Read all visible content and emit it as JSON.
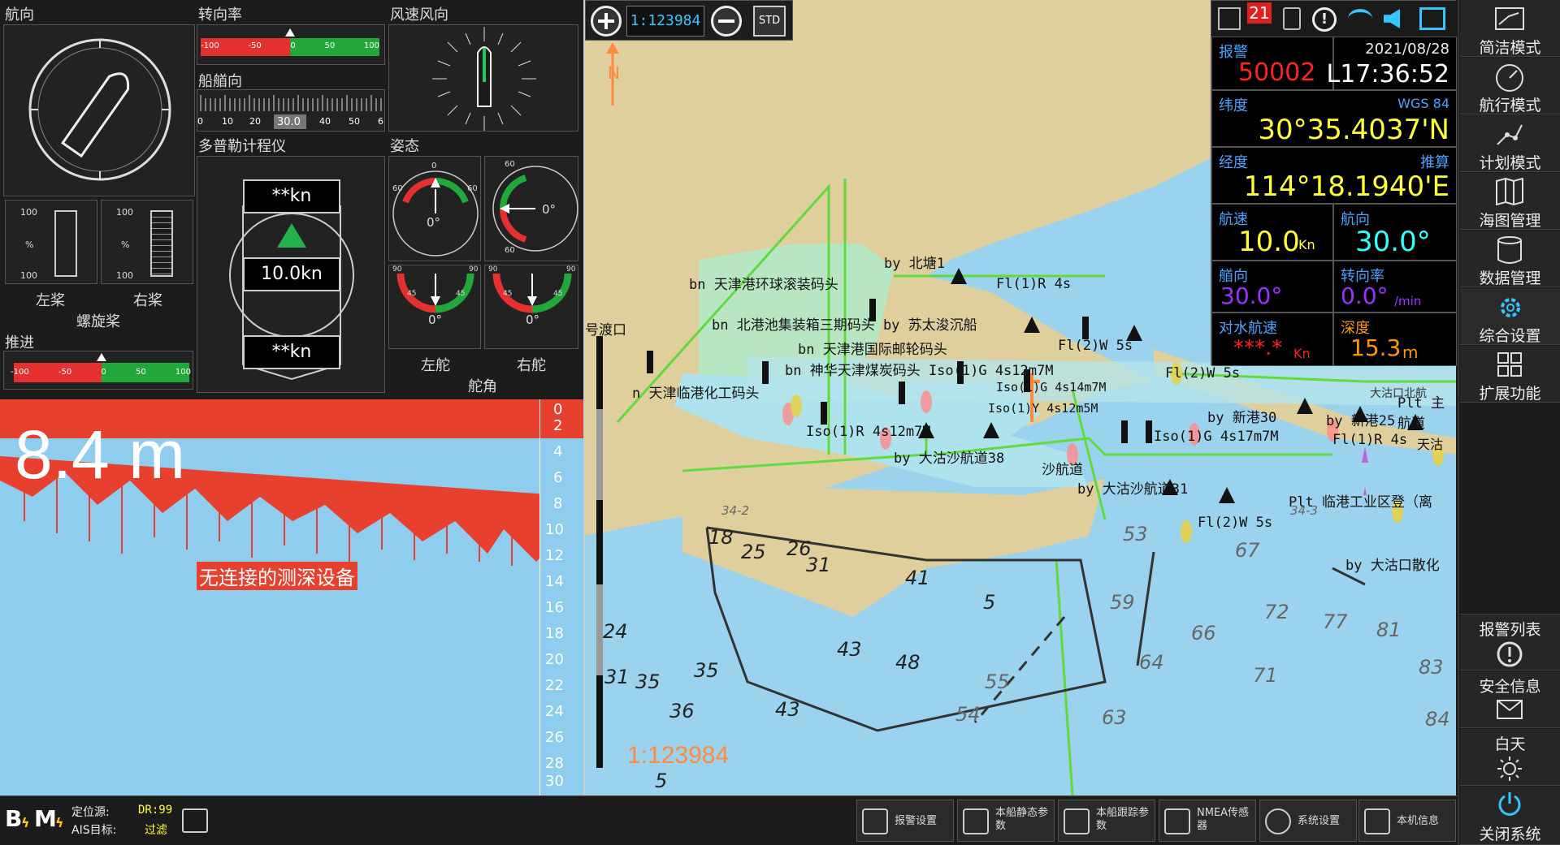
{
  "left": {
    "heading_title": "航向",
    "rot_title": "转向率",
    "rot_ticks": [
      "-100",
      "-50",
      "0",
      "50",
      "100"
    ],
    "ship_heading_title": "船艏向",
    "ship_heading_ticks": [
      "0",
      "10",
      "20",
      "30.0",
      "40",
      "50",
      "6"
    ],
    "wind_title": "风速风向",
    "doppler_title": "多普勒计程仪",
    "doppler_top": "**kn",
    "doppler_mid": "10.0kn",
    "doppler_bottom": "**kn",
    "attitude_title": "姿态",
    "attitude_angle_a": "0°",
    "attitude_angle_b": "0°",
    "attitude_ticks": [
      "0",
      "60",
      "60",
      "60",
      "60"
    ],
    "rudder_left_value": "0°",
    "rudder_right_value": "0°",
    "rudder_ticks": [
      "90",
      "45",
      "45",
      "90"
    ],
    "rudder_left_label": "左舵",
    "rudder_right_label": "右舵",
    "rudder_title": "舵角",
    "prop_scale_top": "100",
    "prop_scale_mid": "%",
    "prop_scale_bottom": "100",
    "prop_left_label": "左桨",
    "prop_right_label": "右桨",
    "prop_title": "螺旋桨",
    "thrust_title": "推进",
    "thrust_ticks": [
      "-100",
      "-50",
      "0",
      "50",
      "100"
    ],
    "depth_value": "8.4 m",
    "depth_no_device": "无连接的测深设备",
    "depth_scale": [
      "0",
      "2",
      "4",
      "6",
      "8",
      "10",
      "12",
      "14",
      "16",
      "18",
      "20",
      "22",
      "24",
      "26",
      "28",
      "30"
    ]
  },
  "map": {
    "scale": "1:123984",
    "scale_overlay": "1:123984",
    "std_label": "STD",
    "north_label": "N",
    "labels": [
      {
        "t": "by 北塘1"
      },
      {
        "t": "bn 天津港环球滚装码头"
      },
      {
        "t": "Fl(1)R 4s"
      },
      {
        "t": "bn 北港池集装箱三期码头 by 苏太浚沉船"
      },
      {
        "t": "bn 天津港国际邮轮码头"
      },
      {
        "t": "Fl(2)W 5s"
      },
      {
        "t": "bn 神华天津煤炭码头 Iso(1)G 4s12m7M"
      },
      {
        "t": "Fl(2)W 5s"
      },
      {
        "t": "n 天津临港化工码头"
      },
      {
        "t": "Iso(1)G 4s14m7M"
      },
      {
        "t": "Iso(1)Y 4s12m5M"
      },
      {
        "t": "by 新港30"
      },
      {
        "t": "by 新港25"
      },
      {
        "t": "Plt 主航道"
      },
      {
        "t": "Iso(1)R 4s12m7M"
      },
      {
        "t": "Iso(1)G 4s17m7M"
      },
      {
        "t": "Fl(1)R 4s"
      },
      {
        "t": "by 大沽沙航道38"
      },
      {
        "t": "沙航道"
      },
      {
        "t": "by 大沽沙航道31"
      },
      {
        "t": "Plt 临港工业区登（离"
      },
      {
        "t": "Fl(2)W 5s"
      },
      {
        "t": "by 大沽口散化"
      },
      {
        "t": "号渡口"
      },
      {
        "t": "大沽口北航"
      },
      {
        "t": "天沽"
      }
    ],
    "soundings": [
      "18",
      "25",
      "26",
      "31",
      "41",
      "5",
      "24",
      "31",
      "35",
      "35",
      "36",
      "43",
      "48",
      "43",
      "5",
      "55",
      "54",
      "59",
      "66",
      "64",
      "63",
      "72",
      "71",
      "77",
      "81",
      "83",
      "84",
      "53",
      "34-2",
      "34-3",
      "67"
    ]
  },
  "info": {
    "alarm_label": "报警",
    "alarm_value": "50002",
    "date": "2021/08/28",
    "time": "L17:36:52",
    "alarm_count": "21",
    "lat_label": "纬度",
    "datum": "WGS 84",
    "lat_value": "30°35.4037'N",
    "lon_label": "经度",
    "lon_mode": "推算",
    "lon_value": "114°18.1940'E",
    "sog_label": "航速",
    "sog_value": "10.0",
    "sog_unit": "Kn",
    "cog_label": "航向",
    "cog_value": "30.0°",
    "hdg_label": "艏向",
    "hdg_value": "30.0°",
    "rot_label": "转向率",
    "rot_value": "0.0°",
    "rot_unit": "/min",
    "stw_label": "对水航速",
    "stw_value": "***.*",
    "stw_unit": "Kn",
    "depth_label": "深度",
    "depth_value": "15.3",
    "depth_unit": "m"
  },
  "side": {
    "items": [
      "简洁模式",
      "航行模式",
      "计划模式",
      "海图管理",
      "数据管理",
      "综合设置",
      "扩展功能"
    ],
    "bottom_items": [
      "报警列表",
      "安全信息",
      "白天",
      "关闭系统"
    ]
  },
  "bottom": {
    "pos_source_label": "定位源:",
    "pos_source_value": "DR:99",
    "ais_label": "AIS目标:",
    "ais_value": "过滤",
    "btn_b": "B",
    "btn_m": "M",
    "buttons": [
      "报警设置",
      "本船静态参数",
      "本船跟踪参数",
      "NMEA传感器",
      "系统设置",
      "本机信息"
    ]
  },
  "colors": {
    "accent": "#3a8ee6",
    "alarm": "#ff2222",
    "value_yellow": "#ffff33",
    "value_purple": "#9933ff",
    "value_cyan": "#33ffff",
    "value_orange": "#ff9900"
  }
}
